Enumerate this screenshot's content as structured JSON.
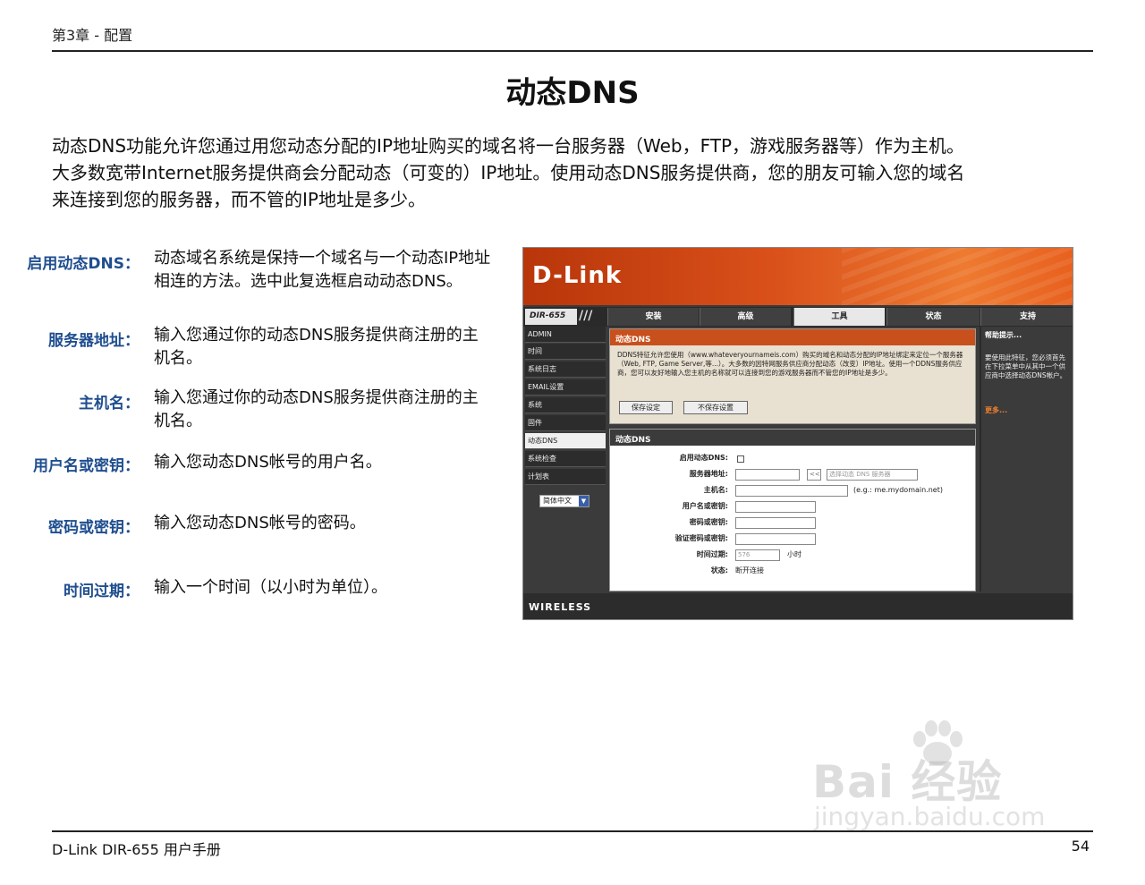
{
  "header": {
    "chapter": "第3章 - 配置"
  },
  "title": "动态DNS",
  "intro": [
    "动态DNS功能允许您通过用您动态分配的IP地址购买的域名将一台服务器（Web，FTP，游戏服务器等）作为主机。",
    "大多数宽带Internet服务提供商会分配动态（可变的）IP地址。使用动态DNS服务提供商，您的朋友可输入您的域名",
    "来连接到您的服务器，而不管的IP地址是多少。"
  ],
  "definitions": [
    {
      "label": "启用动态DNS：",
      "lines": [
        "动态域名系统是保持一个域名与一个动态IP地址",
        "相连的方法。选中此复选框启动动态DNS。"
      ]
    },
    {
      "label": "服务器地址：",
      "lines": [
        "输入您通过你的动态DNS服务提供商注册的主",
        "机名。"
      ]
    },
    {
      "label": "主机名：",
      "lines": [
        "输入您通过你的动态DNS服务提供商注册的主",
        "机名。"
      ]
    },
    {
      "label": "用户名或密钥：",
      "lines": [
        "输入您动态DNS帐号的用户名。"
      ]
    },
    {
      "label": "密码或密钥：",
      "lines": [
        "输入您动态DNS帐号的密码。"
      ]
    },
    {
      "label": "时间过期：",
      "lines": [
        "输入一个时间（以小时为单位）。"
      ]
    }
  ],
  "router": {
    "logo": "D-Link",
    "model": "DIR-655",
    "tabs": [
      "安装",
      "高级",
      "工具",
      "状态",
      "支持"
    ],
    "active_tab": "工具",
    "sidebar": [
      "ADMIN",
      "时间",
      "系统日志",
      "EMAIL设置",
      "系统",
      "固件",
      "动态DNS",
      "系统检查",
      "计划表"
    ],
    "active_side": "动态DNS",
    "language": "简体中文",
    "box1": {
      "title": "动态DNS",
      "text": "DDNS特征允许您使用（www.whateveryournameis.com）购买的域名和动态分配的IP地址绑定来定位一个服务器（Web, FTP, Game Server,等...）。大多数的因特网服务供应商分配动态（改变）IP地址。使用一个DDNS服务供应商，您可以友好地输入您主机的名称就可以连接到您的游戏服务器而不管您的IP地址是多少。",
      "save": "保存设定",
      "nosave": "不保存设置"
    },
    "box2": {
      "title": "动态DNS",
      "fields": {
        "enable": "启用动态DNS:",
        "server": "服务器地址:",
        "host": "主机名:",
        "user": "用户名或密钥:",
        "password": "密码或密钥:",
        "verify": "验证密码或密钥:",
        "timeout": "时间过期:",
        "status": "状态:"
      },
      "server_select": "选择动态 DNS 服务器",
      "server_arrow": "<<",
      "host_example": "(e.g.: me.mydomain.net)",
      "timeout_value": "576",
      "timeout_unit": "小时",
      "status_value": "断开连接"
    },
    "help": {
      "title": "帮助提示...",
      "text": "要使用此特征，您必须首先在下拉菜单中从其中一个供应商中选择动态DNS帐户。",
      "more": "更多..."
    },
    "footer": "WIRELESS"
  },
  "watermark": {
    "brand": "Bai 经验",
    "url": "jingyan.baidu.com"
  },
  "footer": {
    "left": "D-Link DIR-655 用户手册",
    "page": "54"
  }
}
